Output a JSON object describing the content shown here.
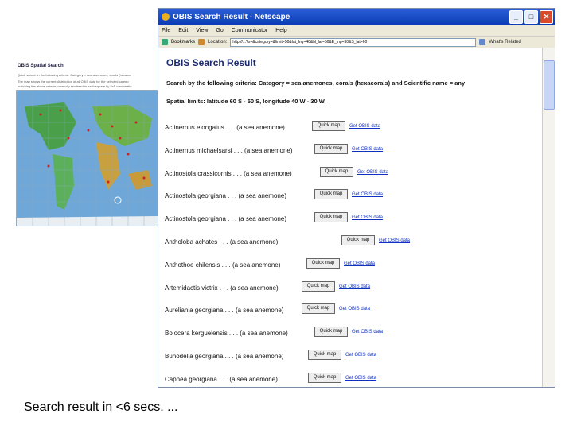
{
  "background_page": {
    "title": "OBIS Spatial Search",
    "line1": "Quick search in the following criteria: Category = sea anemones, corals (hexacor",
    "line2": "The map shows the current distribution of all OBIS data for the selected catego",
    "line3": "matching the above criteria; currently rendered in each square by 5x5 combinatio"
  },
  "window": {
    "title": "OBIS Search Result - Netscape",
    "controls": [
      "_",
      "□",
      "✕"
    ]
  },
  "menu": [
    "File",
    "Edit",
    "View",
    "Go",
    "Communicator",
    "Help"
  ],
  "navbar": {
    "bookmarks": "Bookmarks",
    "location_label": "Location:",
    "location_value": "http://...?x=&category=&limit=50&lat_lng=40&N_lat=50&E_lng=30&S_lat=60",
    "related": "What's Related"
  },
  "content": {
    "title": "OBIS Search Result",
    "criteria1": "Search by the following criteria: Category = sea anemones, corals (hexacorals) and Scientific name = any",
    "criteria2": "Spatial limits: latitude 60 S - 50 S, longitude 40 W - 30 W.",
    "quickmap_label": "Quick map",
    "obis_label": "Get OBIS data",
    "species": [
      {
        "name": "Actinernus elongatus . . . (a sea anemone)"
      },
      {
        "name": "Actinernus michaelsarsi . . . (a sea anemone)"
      },
      {
        "name": "Actinostola crassicornis . . . (a sea anemone)"
      },
      {
        "name": "Actinostola georgiana . . . (a sea anemone)"
      },
      {
        "name": "Actinostola georgiana . . . (a sea anemone)"
      },
      {
        "name": "Antholoba achates . . . (a sea anemone)"
      },
      {
        "name": "Anthothoe chilensis . . . (a sea anemone)"
      },
      {
        "name": "Artemidactis victrix . . . (a sea anemone)"
      },
      {
        "name": "Aureliania georgiana . . . (a sea anemone)"
      },
      {
        "name": "Bolocera kerguelensis . . . (a sea anemone)"
      },
      {
        "name": "Bunodella georgiana . . . (a sea anemone)"
      },
      {
        "name": "Capnea georgiana . . . (a sea anemone)"
      }
    ]
  },
  "caption": "Search result in <6 secs. ..."
}
